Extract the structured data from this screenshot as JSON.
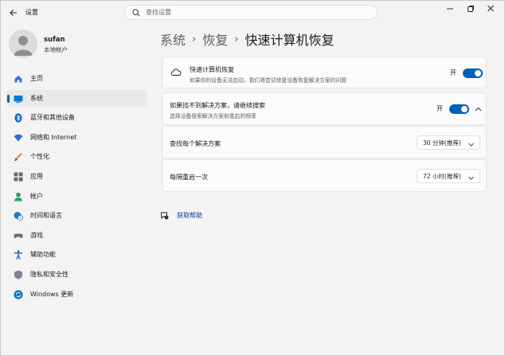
{
  "titlebar": {
    "app_title": "设置",
    "search_placeholder": "查找设置"
  },
  "profile": {
    "name": "sufan",
    "account_type": "本地帐户"
  },
  "sidebar": {
    "items": [
      {
        "label": "主页",
        "icon": "home-icon",
        "color": "#3a6fd8"
      },
      {
        "label": "系统",
        "icon": "system-icon",
        "color": "#0078d4",
        "active": true
      },
      {
        "label": "蓝牙和其他设备",
        "icon": "bluetooth-icon",
        "color": "#0067c0"
      },
      {
        "label": "网络和 Internet",
        "icon": "wifi-icon",
        "color": "#2b6fd6"
      },
      {
        "label": "个性化",
        "icon": "brush-icon",
        "color": "#e48a2a"
      },
      {
        "label": "应用",
        "icon": "apps-icon",
        "color": "#5a6a7a"
      },
      {
        "label": "帐户",
        "icon": "account-icon",
        "color": "#21a366"
      },
      {
        "label": "时间和语言",
        "icon": "globe-clock-icon",
        "color": "#1d7fc4"
      },
      {
        "label": "游戏",
        "icon": "gamepad-icon",
        "color": "#6b6b6b"
      },
      {
        "label": "辅助功能",
        "icon": "accessibility-icon",
        "color": "#1f5fbf"
      },
      {
        "label": "隐私和安全性",
        "icon": "shield-icon",
        "color": "#7a8591"
      },
      {
        "label": "Windows 更新",
        "icon": "update-icon",
        "color": "#1a73c9"
      }
    ]
  },
  "breadcrumb": {
    "level1": "系统",
    "level2": "恢复",
    "current": "快速计算机恢复",
    "separator": "›"
  },
  "quick_recovery": {
    "title": "快速计算机恢复",
    "description": "如果你的设备无法启动，我们将尝试修复设备恢复解决方案的问题",
    "toggle_label": "开",
    "enabled": true
  },
  "continue_search": {
    "title": "如果找不到解决方案，请继续搜索",
    "description": "选择设备搜索解决方案和重启的频率",
    "toggle_label": "开",
    "enabled": true,
    "expanded": true
  },
  "search_interval": {
    "label": "查找每个解决方案",
    "value": "30 分钟(推荐)"
  },
  "restart_interval": {
    "label": "每隔重启一次",
    "value": "72 小时(推荐)"
  },
  "help": {
    "link": "获取帮助"
  },
  "colors": {
    "accent": "#005fb8",
    "background": "#f3f3f3",
    "card": "#fbfbfb"
  }
}
